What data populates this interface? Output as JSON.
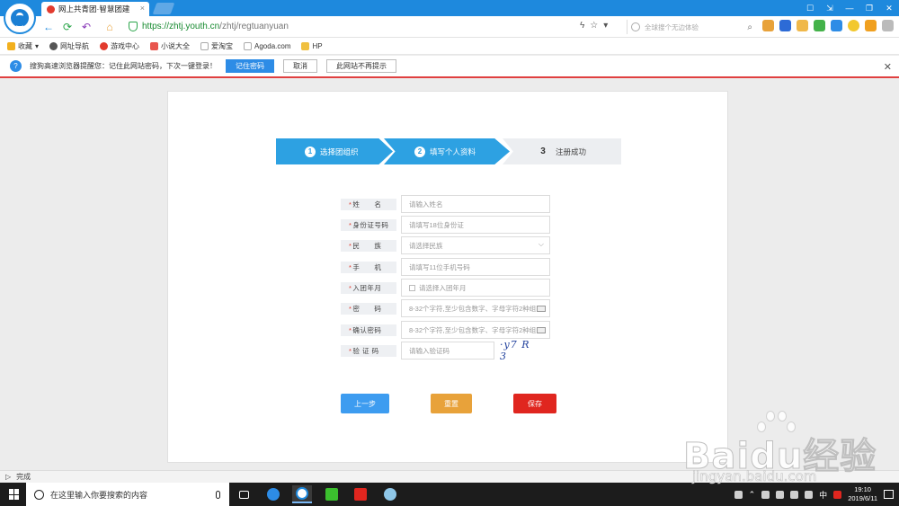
{
  "browser": {
    "tab_title": "网上共青团·智慧团建",
    "tab_close": "×",
    "url_host": "https://zhtj.youth.cn",
    "url_path": "/zhtj/regtuanyuan",
    "search_placeholder": "全球搜个无边体验",
    "win_buttons": [
      "☐",
      "⇲",
      "—",
      "❐",
      "✕"
    ],
    "bookmarks": [
      {
        "label": "收藏",
        "icon": "star-icon",
        "color": "#f2b01e"
      },
      {
        "label": "网址导航",
        "icon": "globe-icon",
        "color": "#555555"
      },
      {
        "label": "游戏中心",
        "icon": "game-icon",
        "color": "#e23b2e"
      },
      {
        "label": "小说大全",
        "icon": "book-icon",
        "color": "#e8554e"
      },
      {
        "label": "爱淘宝",
        "icon": "page-icon",
        "color": "#aaaaaa"
      },
      {
        "label": "Agoda.com",
        "icon": "page-icon",
        "color": "#aaaaaa"
      },
      {
        "label": "HP",
        "icon": "folder-icon",
        "color": "#f0c040"
      }
    ]
  },
  "infobar": {
    "message": "搜狗高速浏览器提醒您：记住此网站密码，下次一键登录！",
    "remember_label": "记住密码",
    "cancel_label": "取消",
    "never_label": "此网站不再提示"
  },
  "steps": [
    {
      "num": "1",
      "label": "选择团组织"
    },
    {
      "num": "2",
      "label": "填写个人资料"
    },
    {
      "num": "3",
      "label": "注册成功"
    }
  ],
  "form": {
    "fields": [
      {
        "label": "姓　　名",
        "placeholder": "请输入姓名"
      },
      {
        "label": "身份证号码",
        "placeholder": "请填写18位身份证"
      },
      {
        "label": "民　　族",
        "placeholder": "请选择民族"
      },
      {
        "label": "手　　机",
        "placeholder": "请填写11位手机号码"
      },
      {
        "label": "入团年月",
        "placeholder": "请选择入团年月"
      },
      {
        "label": "密　　码",
        "placeholder": "8-32个字符,至少包含数字、字母字符2种组"
      },
      {
        "label": "确认密码",
        "placeholder": "8-32个字符,至少包含数字、字母字符2种组"
      },
      {
        "label": "验 证 码",
        "placeholder": "请输入验证码"
      }
    ],
    "required_mark": "*",
    "captcha_text": "·y7 R 3",
    "prev_label": "上一步",
    "reset_label": "重置",
    "save_label": "保存",
    "colors": {
      "prev": "#3d9cf0",
      "reset": "#e8a23a",
      "save": "#e0261f",
      "step_active": "#2da1e2"
    }
  },
  "status": {
    "text": "完成"
  },
  "taskbar": {
    "search_placeholder": "在这里输入你要搜索的内容",
    "time": "19:10",
    "date": "2019/6/11",
    "ime": "中"
  },
  "watermark": {
    "text": "Baidu经验",
    "sub": "jingyan.baidu.com"
  }
}
